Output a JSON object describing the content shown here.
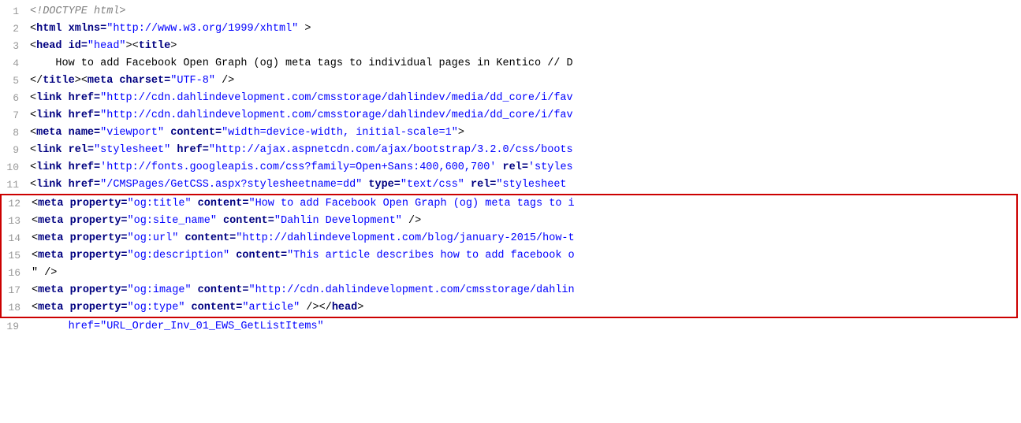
{
  "lines": [
    {
      "num": 1,
      "highlighted": false,
      "parts": [
        {
          "text": "<!DOCTYPE html>",
          "class": "comment"
        }
      ]
    },
    {
      "num": 2,
      "highlighted": false,
      "parts": [
        {
          "text": "<",
          "class": "plain"
        },
        {
          "text": "html",
          "class": "tag"
        },
        {
          "text": " xmlns=",
          "class": "attr-name"
        },
        {
          "text": "\"http://www.w3.org/1999/xhtml\"",
          "class": "string-blue"
        },
        {
          "text": " >",
          "class": "plain"
        }
      ]
    },
    {
      "num": 3,
      "highlighted": false,
      "parts": [
        {
          "text": "<",
          "class": "plain"
        },
        {
          "text": "head",
          "class": "tag"
        },
        {
          "text": " id=",
          "class": "attr-name"
        },
        {
          "text": "\"head\"",
          "class": "string-blue"
        },
        {
          "text": "><",
          "class": "plain"
        },
        {
          "text": "title",
          "class": "tag"
        },
        {
          "text": ">",
          "class": "plain"
        }
      ]
    },
    {
      "num": 4,
      "highlighted": false,
      "parts": [
        {
          "text": "    How to add Facebook Open Graph (og) meta tags to individual pages in Kentico // D",
          "class": "text-content"
        }
      ]
    },
    {
      "num": 5,
      "highlighted": false,
      "parts": [
        {
          "text": "</",
          "class": "plain"
        },
        {
          "text": "title",
          "class": "tag"
        },
        {
          "text": "><",
          "class": "plain"
        },
        {
          "text": "meta",
          "class": "tag"
        },
        {
          "text": " charset=",
          "class": "attr-name"
        },
        {
          "text": "\"UTF-8\"",
          "class": "string-blue"
        },
        {
          "text": " />",
          "class": "plain"
        }
      ]
    },
    {
      "num": 6,
      "highlighted": false,
      "parts": [
        {
          "text": "<",
          "class": "plain"
        },
        {
          "text": "link",
          "class": "tag"
        },
        {
          "text": " href=",
          "class": "attr-name"
        },
        {
          "text": "\"http://cdn.dahlindevelopment.com/cmsstorage/dahlindev/media/dd_core/i/fav",
          "class": "string-blue"
        }
      ]
    },
    {
      "num": 7,
      "highlighted": false,
      "parts": [
        {
          "text": "<",
          "class": "plain"
        },
        {
          "text": "link",
          "class": "tag"
        },
        {
          "text": " href=",
          "class": "attr-name"
        },
        {
          "text": "\"http://cdn.dahlindevelopment.com/cmsstorage/dahlindev/media/dd_core/i/fav",
          "class": "string-blue"
        }
      ]
    },
    {
      "num": 8,
      "highlighted": false,
      "parts": [
        {
          "text": "<",
          "class": "plain"
        },
        {
          "text": "meta",
          "class": "tag"
        },
        {
          "text": " name=",
          "class": "attr-name"
        },
        {
          "text": "\"viewport\"",
          "class": "string-blue"
        },
        {
          "text": " content=",
          "class": "attr-name"
        },
        {
          "text": "\"width=device-width, initial-scale=1\"",
          "class": "string-blue"
        },
        {
          "text": ">",
          "class": "plain"
        }
      ]
    },
    {
      "num": 9,
      "highlighted": false,
      "parts": [
        {
          "text": "<",
          "class": "plain"
        },
        {
          "text": "link",
          "class": "tag"
        },
        {
          "text": " rel=",
          "class": "attr-name"
        },
        {
          "text": "\"stylesheet\"",
          "class": "string-blue"
        },
        {
          "text": " href=",
          "class": "attr-name"
        },
        {
          "text": "\"http://ajax.aspnetcdn.com/ajax/bootstrap/3.2.0/css/boots",
          "class": "string-blue"
        }
      ]
    },
    {
      "num": 10,
      "highlighted": false,
      "parts": [
        {
          "text": "<",
          "class": "plain"
        },
        {
          "text": "link",
          "class": "tag"
        },
        {
          "text": " href=",
          "class": "attr-name"
        },
        {
          "text": "'http://fonts.googleapis.com/css?family=Open+Sans:400,600,700'",
          "class": "string-blue"
        },
        {
          "text": " rel=",
          "class": "attr-name"
        },
        {
          "text": "'styles",
          "class": "string-blue"
        }
      ]
    },
    {
      "num": 11,
      "highlighted": false,
      "parts": [
        {
          "text": "<",
          "class": "plain"
        },
        {
          "text": "link",
          "class": "tag"
        },
        {
          "text": " href=",
          "class": "attr-name"
        },
        {
          "text": "\"/CMSPages/GetCSS.aspx?stylesheetname=dd\"",
          "class": "string-blue"
        },
        {
          "text": " type=",
          "class": "attr-name"
        },
        {
          "text": "\"text/css\"",
          "class": "string-blue"
        },
        {
          "text": " rel=",
          "class": "attr-name"
        },
        {
          "text": "\"stylesheet",
          "class": "string-blue"
        }
      ]
    },
    {
      "num": 12,
      "highlighted": true,
      "parts": [
        {
          "text": "<",
          "class": "plain"
        },
        {
          "text": "meta",
          "class": "tag"
        },
        {
          "text": " property=",
          "class": "attr-name"
        },
        {
          "text": "\"og:title\"",
          "class": "string-blue"
        },
        {
          "text": " content=",
          "class": "attr-name"
        },
        {
          "text": "\"How to add Facebook Open Graph (og) meta tags to i",
          "class": "string-blue"
        }
      ]
    },
    {
      "num": 13,
      "highlighted": true,
      "parts": [
        {
          "text": "<",
          "class": "plain"
        },
        {
          "text": "meta",
          "class": "tag"
        },
        {
          "text": " property=",
          "class": "attr-name"
        },
        {
          "text": "\"og:site_name\"",
          "class": "string-blue"
        },
        {
          "text": " content=",
          "class": "attr-name"
        },
        {
          "text": "\"Dahlin Development\"",
          "class": "string-blue"
        },
        {
          "text": " />",
          "class": "plain"
        }
      ]
    },
    {
      "num": 14,
      "highlighted": true,
      "parts": [
        {
          "text": "<",
          "class": "plain"
        },
        {
          "text": "meta",
          "class": "tag"
        },
        {
          "text": " property=",
          "class": "attr-name"
        },
        {
          "text": "\"og:url\"",
          "class": "string-blue"
        },
        {
          "text": " content=",
          "class": "attr-name"
        },
        {
          "text": "\"http://dahlindevelopment.com/blog/january-2015/how-t",
          "class": "string-blue"
        }
      ]
    },
    {
      "num": 15,
      "highlighted": true,
      "parts": [
        {
          "text": "<",
          "class": "plain"
        },
        {
          "text": "meta",
          "class": "tag"
        },
        {
          "text": " property=",
          "class": "attr-name"
        },
        {
          "text": "\"og:description\"",
          "class": "string-blue"
        },
        {
          "text": " content=",
          "class": "attr-name"
        },
        {
          "text": "\"This article describes how to add facebook o",
          "class": "string-blue"
        }
      ]
    },
    {
      "num": 16,
      "highlighted": true,
      "parts": [
        {
          "text": "\" />",
          "class": "plain"
        }
      ]
    },
    {
      "num": 17,
      "highlighted": true,
      "parts": [
        {
          "text": "<",
          "class": "plain"
        },
        {
          "text": "meta",
          "class": "tag"
        },
        {
          "text": " property=",
          "class": "attr-name"
        },
        {
          "text": "\"og:image\"",
          "class": "string-blue"
        },
        {
          "text": " content=",
          "class": "attr-name"
        },
        {
          "text": "\"http://cdn.dahlindevelopment.com/cmsstorage/dahlin",
          "class": "string-blue"
        }
      ]
    },
    {
      "num": 18,
      "highlighted": true,
      "parts": [
        {
          "text": "<",
          "class": "plain"
        },
        {
          "text": "meta",
          "class": "tag"
        },
        {
          "text": " property=",
          "class": "attr-name"
        },
        {
          "text": "\"og:type\"",
          "class": "string-blue"
        },
        {
          "text": " content=",
          "class": "attr-name"
        },
        {
          "text": "\"article\"",
          "class": "string-blue"
        },
        {
          "text": " /></",
          "class": "plain"
        },
        {
          "text": "head",
          "class": "tag"
        },
        {
          "text": ">",
          "class": "plain"
        }
      ]
    },
    {
      "num": 19,
      "highlighted": false,
      "parts": [
        {
          "text": "      href=\"URL_Order_Inv_01_EWS_GetListItems\"",
          "class": "string-blue"
        }
      ]
    }
  ]
}
